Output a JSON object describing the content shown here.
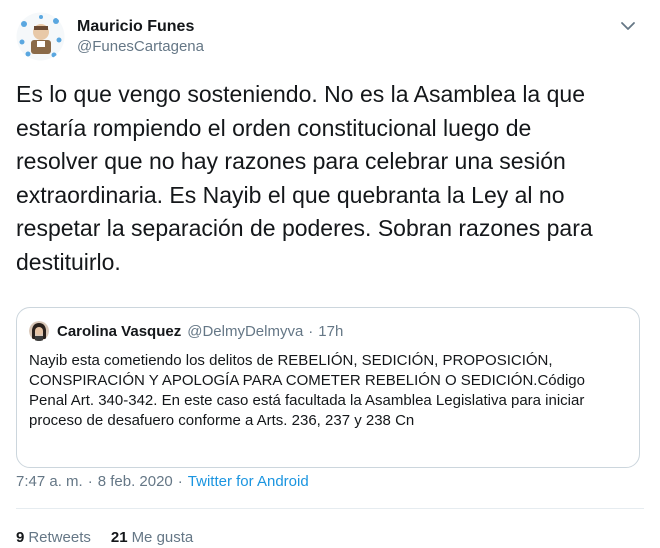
{
  "author": {
    "name": "Mauricio Funes",
    "handle": "@FunesCartagena"
  },
  "tweet": {
    "text": "Es lo que vengo sosteniendo. No es la Asamblea la que\nestaría rompiendo el orden constitucional luego de\nresolver que no hay razones para celebrar una sesión\nextraordinaria. Es Nayib el que quebranta la Ley al no\nrespetar la separación de poderes. Sobran razones para\ndestituirlo."
  },
  "quoted": {
    "name": "Carolina Vasquez",
    "handle": "@DelmyDelmyva",
    "separator": "·",
    "time": "17h",
    "text": "Nayib esta cometiendo los delitos de REBELIÓN, SEDICIÓN, PROPOSICIÓN,\nCONSPIRACIÓN Y APOLOGÍA PARA COMETER REBELIÓN O SEDICIÓN.Código\nPenal Art. 340-342. En este caso está facultada la Asamblea Legislativa para iniciar\nproceso de desafuero conforme a Arts. 236, 237 y 238 Cn"
  },
  "meta": {
    "time": "7:47 a. m.",
    "separator": "·",
    "date": "8 feb. 2020",
    "source": "Twitter for Android"
  },
  "stats": {
    "retweets_count": "9",
    "retweets_label": "Retweets",
    "likes_count": "21",
    "likes_label": "Me gusta"
  },
  "icons": {
    "caret": "chevron-down-icon",
    "avatar": "avatar-icon"
  },
  "colors": {
    "text": "#14171a",
    "secondary": "#657786",
    "link": "#1b95e0",
    "border": "#ccd6dd",
    "divider": "#e6ecf0"
  }
}
